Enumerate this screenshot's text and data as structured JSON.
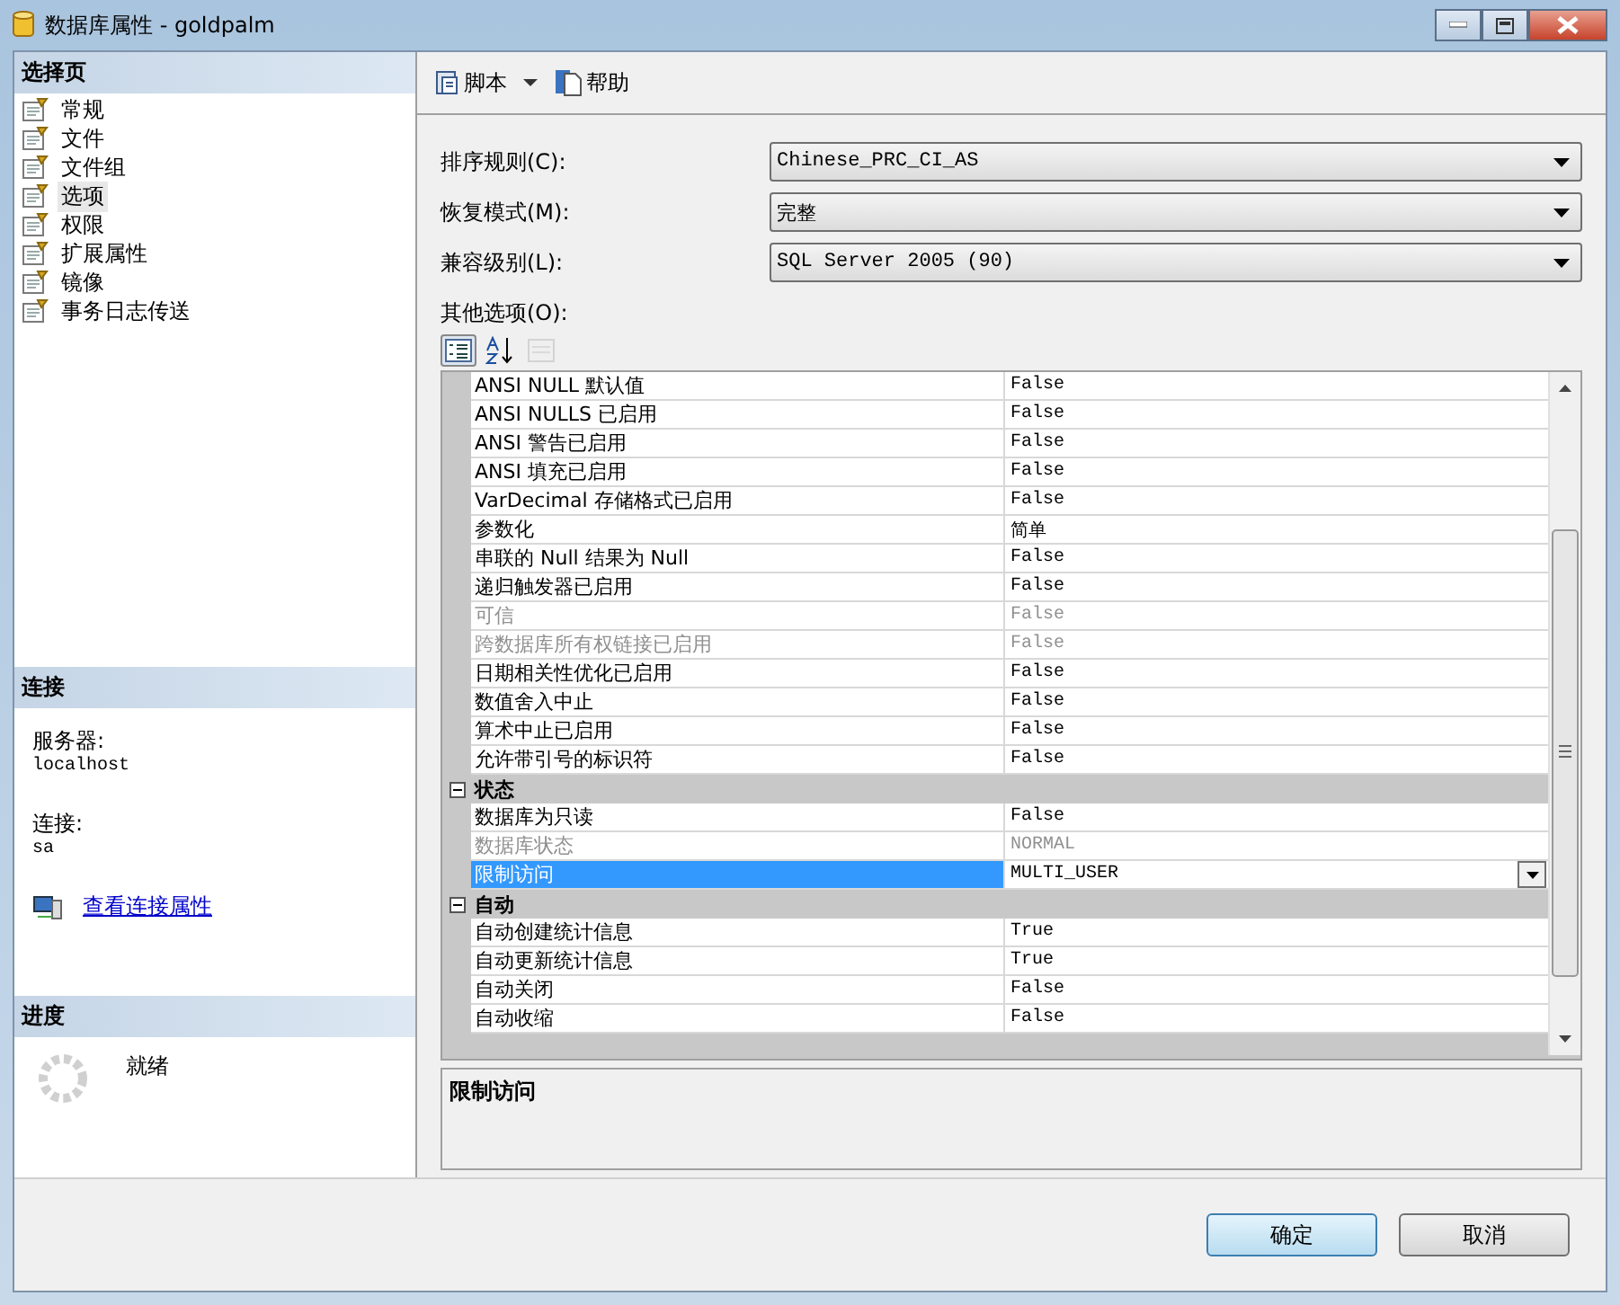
{
  "window": {
    "title": "数据库属性 - goldpalm"
  },
  "sidebar": {
    "header": "选择页",
    "items": [
      {
        "label": "常规",
        "selected": false
      },
      {
        "label": "文件",
        "selected": false
      },
      {
        "label": "文件组",
        "selected": false
      },
      {
        "label": "选项",
        "selected": true
      },
      {
        "label": "权限",
        "selected": false
      },
      {
        "label": "扩展属性",
        "selected": false
      },
      {
        "label": "镜像",
        "selected": false
      },
      {
        "label": "事务日志传送",
        "selected": false
      }
    ]
  },
  "connection": {
    "header": "连接",
    "fields": [
      {
        "label": "服务器:",
        "value": "localhost"
      },
      {
        "label": "连接:",
        "value": "sa"
      }
    ],
    "link": "查看连接属性"
  },
  "progress": {
    "header": "进度",
    "status": "就绪"
  },
  "toolbar": {
    "items": [
      {
        "kind": "script",
        "label": "脚本"
      },
      {
        "kind": "help",
        "label": "帮助"
      }
    ]
  },
  "form": {
    "fields": [
      {
        "label": "排序规则(C):",
        "value": "Chinese_PRC_CI_AS"
      },
      {
        "label": "恢复模式(M):",
        "value": "完整"
      },
      {
        "label": "兼容级别(L):",
        "value": "SQL Server 2005 (90)"
      }
    ],
    "other_label": "其他选项(O):"
  },
  "grid": {
    "view_buttons": [
      {
        "kind": "categorized",
        "selected": true
      },
      {
        "kind": "alphabetical",
        "selected": false
      },
      {
        "kind": "pages",
        "disabled": true
      }
    ],
    "rows": [
      {
        "kind": "property",
        "name": "ANSI NULL 默认值",
        "value": "False",
        "disabled": false,
        "selected": false
      },
      {
        "kind": "property",
        "name": "ANSI NULLS 已启用",
        "value": "False",
        "disabled": false,
        "selected": false
      },
      {
        "kind": "property",
        "name": "ANSI 警告已启用",
        "value": "False",
        "disabled": false,
        "selected": false
      },
      {
        "kind": "property",
        "name": "ANSI 填充已启用",
        "value": "False",
        "disabled": false,
        "selected": false
      },
      {
        "kind": "property",
        "name": "VarDecimal 存储格式已启用",
        "value": "False",
        "disabled": false,
        "selected": false
      },
      {
        "kind": "property",
        "name": "参数化",
        "value": "简单",
        "disabled": false,
        "selected": false
      },
      {
        "kind": "property",
        "name": "串联的 Null 结果为 Null",
        "value": "False",
        "disabled": false,
        "selected": false
      },
      {
        "kind": "property",
        "name": "递归触发器已启用",
        "value": "False",
        "disabled": false,
        "selected": false
      },
      {
        "kind": "property",
        "name": "可信",
        "value": "False",
        "disabled": true,
        "selected": false
      },
      {
        "kind": "property",
        "name": "跨数据库所有权链接已启用",
        "value": "False",
        "disabled": true,
        "selected": false
      },
      {
        "kind": "property",
        "name": "日期相关性优化已启用",
        "value": "False",
        "disabled": false,
        "selected": false
      },
      {
        "kind": "property",
        "name": "数值舍入中止",
        "value": "False",
        "disabled": false,
        "selected": false
      },
      {
        "kind": "property",
        "name": "算术中止已启用",
        "value": "False",
        "disabled": false,
        "selected": false
      },
      {
        "kind": "property",
        "name": "允许带引号的标识符",
        "value": "False",
        "disabled": false,
        "selected": false
      },
      {
        "kind": "category",
        "name": "状态",
        "expanded": true,
        "children": [
          {
            "kind": "property",
            "name": "数据库为只读",
            "value": "False",
            "disabled": false,
            "selected": false
          },
          {
            "kind": "property",
            "name": "数据库状态",
            "value": "NORMAL",
            "disabled": true,
            "selected": false
          },
          {
            "kind": "property",
            "name": "限制访问",
            "value": "MULTI_USER",
            "disabled": false,
            "selected": true
          }
        ]
      },
      {
        "kind": "category",
        "name": "自动",
        "expanded": true,
        "children": [
          {
            "kind": "property",
            "name": "自动创建统计信息",
            "value": "True",
            "disabled": false,
            "selected": false
          },
          {
            "kind": "property",
            "name": "自动更新统计信息",
            "value": "True",
            "disabled": false,
            "selected": false
          },
          {
            "kind": "property",
            "name": "自动关闭",
            "value": "False",
            "disabled": false,
            "selected": false
          },
          {
            "kind": "property",
            "name": "自动收缩",
            "value": "False",
            "disabled": false,
            "selected": false
          }
        ]
      }
    ]
  },
  "description": {
    "title": "限制访问"
  },
  "buttons": [
    {
      "label": "确定",
      "default": true
    },
    {
      "label": "取消",
      "default": false
    }
  ]
}
